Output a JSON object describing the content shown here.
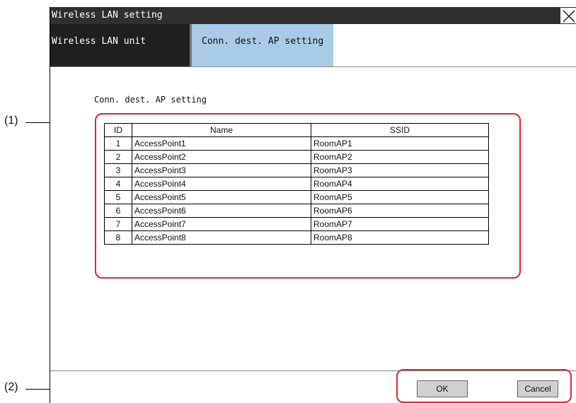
{
  "window": {
    "title": "Wireless LAN setting"
  },
  "tabs": [
    {
      "label": "Wireless LAN unit setting"
    },
    {
      "label": "Conn. dest. AP setting"
    }
  ],
  "section": {
    "label": "Conn. dest. AP setting"
  },
  "table": {
    "headers": {
      "id": "ID",
      "name": "Name",
      "ssid": "SSID"
    },
    "rows": [
      {
        "id": "1",
        "name": "AccessPoint1",
        "ssid": "RoomAP1"
      },
      {
        "id": "2",
        "name": "AccessPoint2",
        "ssid": "RoomAP2"
      },
      {
        "id": "3",
        "name": "AccessPoint3",
        "ssid": "RoomAP3"
      },
      {
        "id": "4",
        "name": "AccessPoint4",
        "ssid": "RoomAP4"
      },
      {
        "id": "5",
        "name": "AccessPoint5",
        "ssid": "RoomAP5"
      },
      {
        "id": "6",
        "name": "AccessPoint6",
        "ssid": "RoomAP6"
      },
      {
        "id": "7",
        "name": "AccessPoint7",
        "ssid": "RoomAP7"
      },
      {
        "id": "8",
        "name": "AccessPoint8",
        "ssid": "RoomAP8"
      }
    ]
  },
  "buttons": {
    "ok": "OK",
    "cancel": "Cancel"
  },
  "annotations": {
    "one": "(1)",
    "two": "(2)"
  },
  "colors": {
    "highlight": "#e0243a",
    "active_tab": "#a9cbe7",
    "titlebar": "#2f2f2f"
  },
  "icons": {
    "close": "close-icon"
  }
}
